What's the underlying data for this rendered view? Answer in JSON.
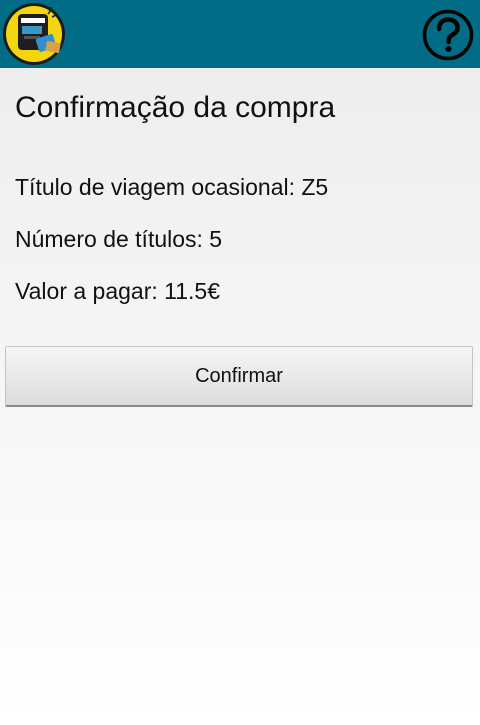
{
  "header": {
    "logo_icon": "ticket-machine-logo-icon",
    "help_icon": "question-mark-circle-icon",
    "background_color": "#006c86"
  },
  "main": {
    "title": "Confirmação da compra",
    "ticket_line": "Título de viagem ocasional: Z5",
    "count_line": "Número de títulos: 5",
    "amount_line": "Valor a pagar: 11.5€",
    "confirm_label": "Confirmar"
  }
}
